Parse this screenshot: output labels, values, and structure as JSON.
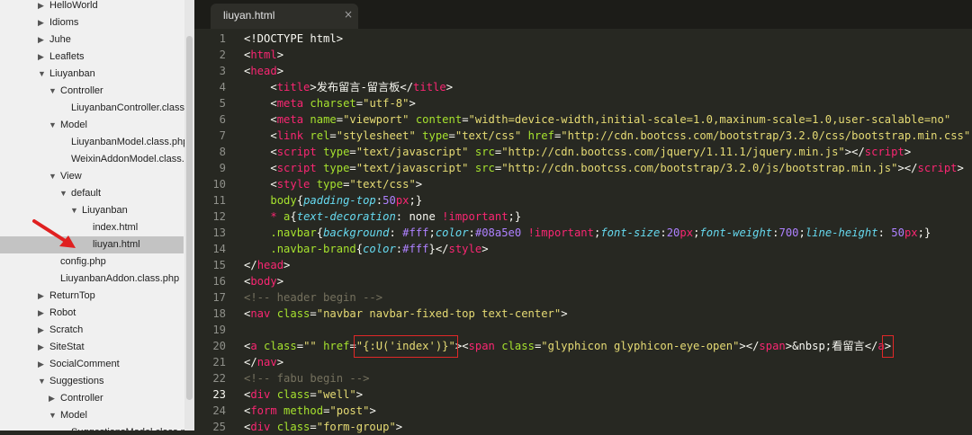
{
  "sidebar": {
    "items": [
      {
        "label": "HelloWorld",
        "level": 2,
        "expanded": false
      },
      {
        "label": "Idioms",
        "level": 2,
        "expanded": false
      },
      {
        "label": "Juhe",
        "level": 2,
        "expanded": false
      },
      {
        "label": "Leaflets",
        "level": 2,
        "expanded": false
      },
      {
        "label": "Liuyanban",
        "level": 2,
        "expanded": true
      },
      {
        "label": "Controller",
        "level": 3,
        "expanded": true
      },
      {
        "label": "LiuyanbanController.class.php",
        "level": 4,
        "file": true
      },
      {
        "label": "Model",
        "level": 3,
        "expanded": true
      },
      {
        "label": "LiuyanbanModel.class.php",
        "level": 4,
        "file": true
      },
      {
        "label": "WeixinAddonModel.class.php",
        "level": 4,
        "file": true
      },
      {
        "label": "View",
        "level": 3,
        "expanded": true
      },
      {
        "label": "default",
        "level": 4,
        "expanded": true
      },
      {
        "label": "Liuyanban",
        "level": 5,
        "expanded": true
      },
      {
        "label": "index.html",
        "level": 6,
        "file": true
      },
      {
        "label": "liuyan.html",
        "level": 6,
        "file": true,
        "selected": true
      },
      {
        "label": "config.php",
        "level": 3,
        "file": true
      },
      {
        "label": "LiuyanbanAddon.class.php",
        "level": 3,
        "file": true
      },
      {
        "label": "ReturnTop",
        "level": 2,
        "expanded": false
      },
      {
        "label": "Robot",
        "level": 2,
        "expanded": false
      },
      {
        "label": "Scratch",
        "level": 2,
        "expanded": false
      },
      {
        "label": "SiteStat",
        "level": 2,
        "expanded": false
      },
      {
        "label": "SocialComment",
        "level": 2,
        "expanded": false
      },
      {
        "label": "Suggestions",
        "level": 2,
        "expanded": true
      },
      {
        "label": "Controller",
        "level": 3,
        "expanded": false
      },
      {
        "label": "Model",
        "level": 3,
        "expanded": true
      },
      {
        "label": "SuggestionsModel.class.php",
        "level": 4,
        "file": true
      }
    ]
  },
  "editor": {
    "tab": {
      "label": "liuyan.html",
      "close": "×"
    },
    "current_line": 23,
    "colors": {
      "background": "#272822",
      "tag": "#f92672",
      "attr": "#a6e22e",
      "string": "#e6db74",
      "comment": "#75715e",
      "property": "#66d9ef",
      "number": "#ae81ff",
      "text": "#f8f8f2",
      "highlight_box": "#e02828",
      "selected_row": "#c3c3c3"
    },
    "lines": [
      [
        [
          "t",
          "<!DOCTYPE html>"
        ]
      ],
      [
        [
          "t",
          "<"
        ],
        [
          "k",
          "html"
        ],
        [
          "t",
          ">"
        ]
      ],
      [
        [
          "t",
          "<"
        ],
        [
          "k",
          "head"
        ],
        [
          "t",
          ">"
        ]
      ],
      [
        [
          "t",
          "    <"
        ],
        [
          "k",
          "title"
        ],
        [
          "t",
          ">发布留言-留言板</"
        ],
        [
          "k",
          "title"
        ],
        [
          "t",
          ">"
        ]
      ],
      [
        [
          "t",
          "    <"
        ],
        [
          "k",
          "meta"
        ],
        [
          "t",
          " "
        ],
        [
          "a",
          "charset"
        ],
        [
          "t",
          "="
        ],
        [
          "s",
          "\"utf-8\""
        ],
        [
          "t",
          ">"
        ]
      ],
      [
        [
          "t",
          "    <"
        ],
        [
          "k",
          "meta"
        ],
        [
          "t",
          " "
        ],
        [
          "a",
          "name"
        ],
        [
          "t",
          "="
        ],
        [
          "s",
          "\"viewport\""
        ],
        [
          "t",
          " "
        ],
        [
          "a",
          "content"
        ],
        [
          "t",
          "="
        ],
        [
          "s",
          "\"width=device-width,initial-scale=1.0,maxinum-scale=1.0,user-scalable=no\""
        ]
      ],
      [
        [
          "t",
          "    <"
        ],
        [
          "k",
          "link"
        ],
        [
          "t",
          " "
        ],
        [
          "a",
          "rel"
        ],
        [
          "t",
          "="
        ],
        [
          "s",
          "\"stylesheet\""
        ],
        [
          "t",
          " "
        ],
        [
          "a",
          "type"
        ],
        [
          "t",
          "="
        ],
        [
          "s",
          "\"text/css\""
        ],
        [
          "t",
          " "
        ],
        [
          "a",
          "href"
        ],
        [
          "t",
          "="
        ],
        [
          "s",
          "\"http://cdn.bootcss.com/bootstrap/3.2.0/css/bootstrap.min.css\""
        ]
      ],
      [
        [
          "t",
          "    <"
        ],
        [
          "k",
          "script"
        ],
        [
          "t",
          " "
        ],
        [
          "a",
          "type"
        ],
        [
          "t",
          "="
        ],
        [
          "s",
          "\"text/javascript\""
        ],
        [
          "t",
          " "
        ],
        [
          "a",
          "src"
        ],
        [
          "t",
          "="
        ],
        [
          "s",
          "\"http://cdn.bootcss.com/jquery/1.11.1/jquery.min.js\""
        ],
        [
          "t",
          "></"
        ],
        [
          "k",
          "script"
        ],
        [
          "t",
          ">"
        ]
      ],
      [
        [
          "t",
          "    <"
        ],
        [
          "k",
          "script"
        ],
        [
          "t",
          " "
        ],
        [
          "a",
          "type"
        ],
        [
          "t",
          "="
        ],
        [
          "s",
          "\"text/javascript\""
        ],
        [
          "t",
          " "
        ],
        [
          "a",
          "src"
        ],
        [
          "t",
          "="
        ],
        [
          "s",
          "\"http://cdn.bootcss.com/bootstrap/3.2.0/js/bootstrap.min.js\""
        ],
        [
          "t",
          "></"
        ],
        [
          "k",
          "script"
        ],
        [
          "t",
          ">"
        ]
      ],
      [
        [
          "t",
          "    <"
        ],
        [
          "k",
          "style"
        ],
        [
          "t",
          " "
        ],
        [
          "a",
          "type"
        ],
        [
          "t",
          "="
        ],
        [
          "s",
          "\"text/css\""
        ],
        [
          "t",
          ">"
        ]
      ],
      [
        [
          "t",
          "    "
        ],
        [
          "a",
          "body"
        ],
        [
          "t",
          "{"
        ],
        [
          "p",
          "padding-top"
        ],
        [
          "t",
          ":"
        ],
        [
          "n",
          "50"
        ],
        [
          "k",
          "px"
        ],
        [
          "t",
          ";}"
        ]
      ],
      [
        [
          "t",
          "    "
        ],
        [
          "k",
          "*"
        ],
        [
          "t",
          " "
        ],
        [
          "a",
          "a"
        ],
        [
          "t",
          "{"
        ],
        [
          "p",
          "text-decoration"
        ],
        [
          "t",
          ": none "
        ],
        [
          "k",
          "!important"
        ],
        [
          "t",
          ";}"
        ]
      ],
      [
        [
          "t",
          "    "
        ],
        [
          "a",
          ".navbar"
        ],
        [
          "t",
          "{"
        ],
        [
          "p",
          "background"
        ],
        [
          "t",
          ": "
        ],
        [
          "n",
          "#fff"
        ],
        [
          "t",
          ";"
        ],
        [
          "p",
          "color"
        ],
        [
          "t",
          ":"
        ],
        [
          "n",
          "#08a5e0"
        ],
        [
          "t",
          " "
        ],
        [
          "k",
          "!important"
        ],
        [
          "t",
          ";"
        ],
        [
          "p",
          "font-size"
        ],
        [
          "t",
          ":"
        ],
        [
          "n",
          "20"
        ],
        [
          "k",
          "px"
        ],
        [
          "t",
          ";"
        ],
        [
          "p",
          "font-weight"
        ],
        [
          "t",
          ":"
        ],
        [
          "n",
          "700"
        ],
        [
          "t",
          ";"
        ],
        [
          "p",
          "line-height"
        ],
        [
          "t",
          ": "
        ],
        [
          "n",
          "50"
        ],
        [
          "k",
          "px"
        ],
        [
          "t",
          ";}"
        ]
      ],
      [
        [
          "t",
          "    "
        ],
        [
          "a",
          ".navbar-brand"
        ],
        [
          "t",
          "{"
        ],
        [
          "p",
          "color"
        ],
        [
          "t",
          ":"
        ],
        [
          "n",
          "#fff"
        ],
        [
          "t",
          "}</"
        ],
        [
          "k",
          "style"
        ],
        [
          "t",
          ">"
        ]
      ],
      [
        [
          "t",
          "</"
        ],
        [
          "k",
          "head"
        ],
        [
          "t",
          ">"
        ]
      ],
      [
        [
          "t",
          "<"
        ],
        [
          "k",
          "body"
        ],
        [
          "t",
          ">"
        ]
      ],
      [
        [
          "c",
          "<!-- header begin -->"
        ]
      ],
      [
        [
          "t",
          "<"
        ],
        [
          "k",
          "nav"
        ],
        [
          "t",
          " "
        ],
        [
          "a",
          "class"
        ],
        [
          "t",
          "="
        ],
        [
          "s",
          "\"navbar navbar-fixed-top text-center\""
        ],
        [
          "t",
          ">"
        ]
      ],
      [
        [
          "t",
          ""
        ]
      ],
      [
        [
          "t",
          "<"
        ],
        [
          "k",
          "a"
        ],
        [
          "t",
          " "
        ],
        [
          "a",
          "class"
        ],
        [
          "t",
          "="
        ],
        [
          "s",
          "\"\""
        ],
        [
          "t",
          " "
        ],
        [
          "a",
          "href"
        ],
        [
          "t",
          "="
        ],
        [
          "s",
          "\"{:U('index')}\""
        ],
        [
          "t",
          ">"
        ],
        [
          "t",
          "<"
        ],
        [
          "k",
          "span"
        ],
        [
          "t",
          " "
        ],
        [
          "a",
          "class"
        ],
        [
          "t",
          "="
        ],
        [
          "s",
          "\"glyphicon glyphicon-eye-open\""
        ],
        [
          "t",
          "></"
        ],
        [
          "k",
          "span"
        ],
        [
          "t",
          ">&nbsp;看留言</"
        ],
        [
          "k",
          "a"
        ],
        [
          "t",
          ">"
        ]
      ],
      [
        [
          "t",
          "</"
        ],
        [
          "k",
          "nav"
        ],
        [
          "t",
          ">"
        ]
      ],
      [
        [
          "c",
          "<!-- fabu begin -->"
        ]
      ],
      [
        [
          "t",
          "<"
        ],
        [
          "k",
          "div"
        ],
        [
          "t",
          " "
        ],
        [
          "a",
          "class"
        ],
        [
          "t",
          "="
        ],
        [
          "s",
          "\"well\""
        ],
        [
          "t",
          ">"
        ]
      ],
      [
        [
          "t",
          "<"
        ],
        [
          "k",
          "form"
        ],
        [
          "t",
          " "
        ],
        [
          "a",
          "method"
        ],
        [
          "t",
          "="
        ],
        [
          "s",
          "\"post\""
        ],
        [
          "t",
          ">"
        ]
      ],
      [
        [
          "t",
          "<"
        ],
        [
          "k",
          "div"
        ],
        [
          "t",
          " "
        ],
        [
          "a",
          "class"
        ],
        [
          "t",
          "="
        ],
        [
          "s",
          "\"form-group\""
        ],
        [
          "t",
          ">"
        ]
      ]
    ]
  }
}
